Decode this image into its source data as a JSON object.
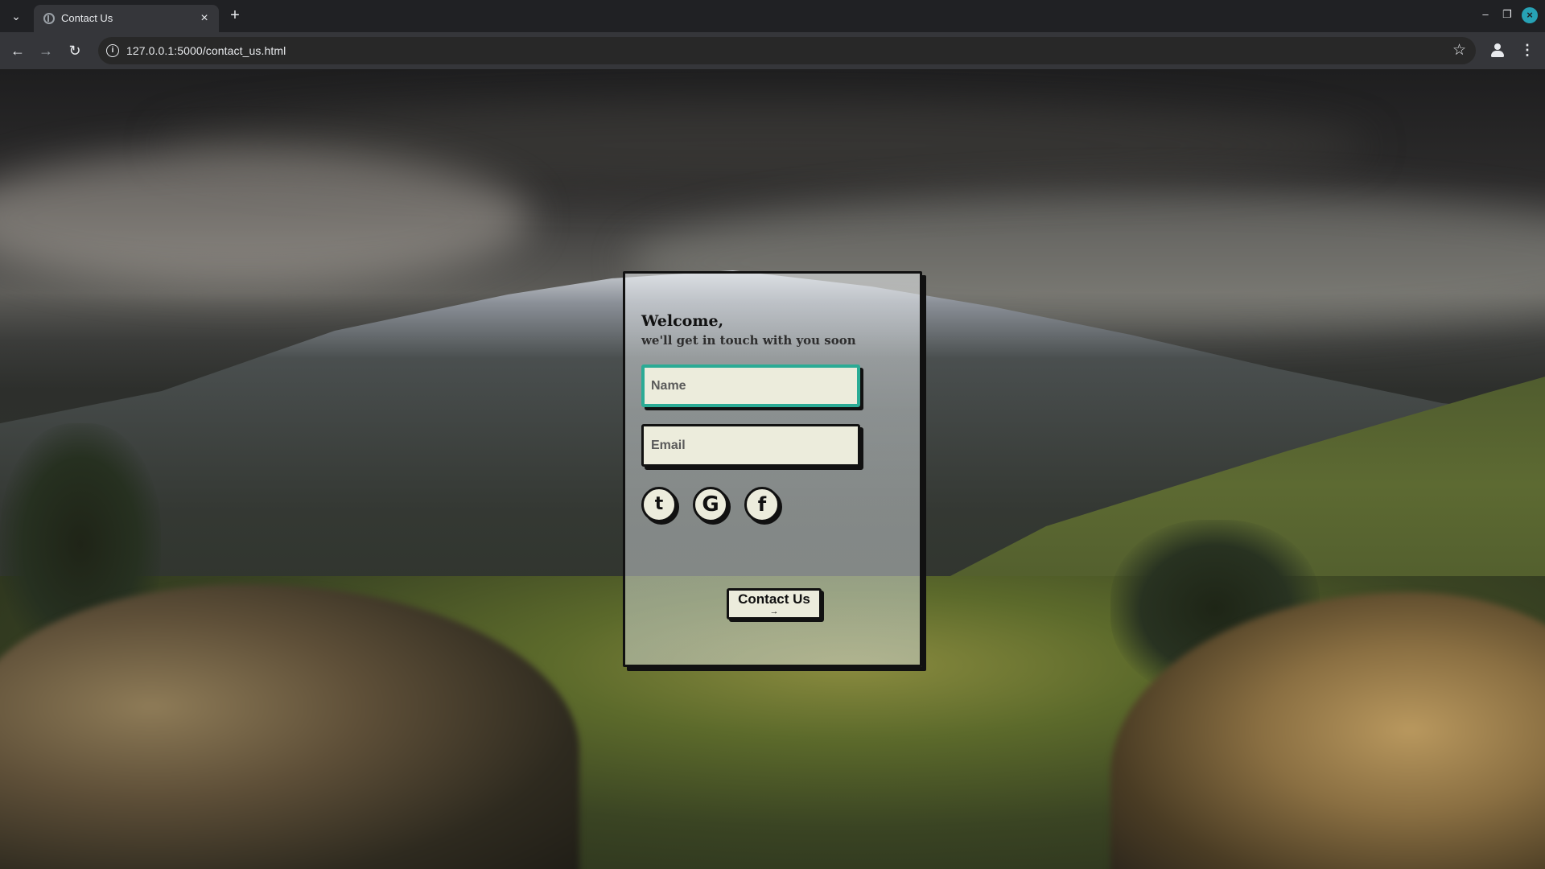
{
  "browser": {
    "tab_title": "Contact Us",
    "url": "127.0.0.1:5000/contact_us.html",
    "icons": {
      "tab_search": "chevron-down-icon",
      "new_tab": "plus-icon",
      "back": "arrow-left-icon",
      "forward": "arrow-right-icon",
      "reload": "reload-icon",
      "site_info": "info-icon",
      "bookmark": "star-icon",
      "profile": "profile-icon",
      "menu": "kebab-menu-icon"
    }
  },
  "contact_card": {
    "welcome": "Welcome,",
    "subtitle": "we'll get in touch with you soon",
    "name_placeholder": "Name",
    "email_placeholder": "Email",
    "socials": [
      {
        "label": "t",
        "icon": "twitter-icon"
      },
      {
        "label": "G",
        "icon": "google-icon"
      },
      {
        "label": "f",
        "icon": "facebook-icon"
      }
    ],
    "submit_label": "Contact Us",
    "submit_arrow": "→"
  },
  "colors": {
    "card_border": "#111111",
    "input_fill": "#ececdc",
    "focus_accent": "#2bab95",
    "browser_frame": "#202124",
    "toolbar": "#35363a"
  }
}
